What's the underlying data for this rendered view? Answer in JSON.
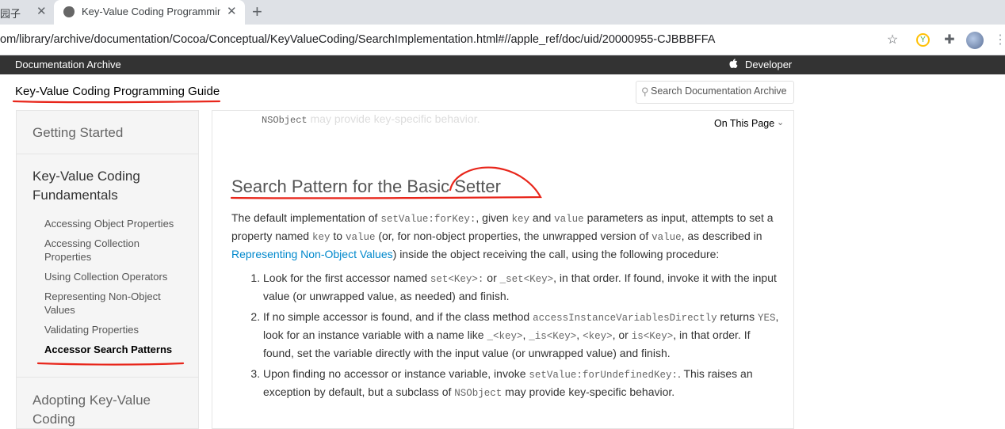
{
  "browser": {
    "prev_tab_title": "园子",
    "active_tab_title": "Key-Value Coding Programming Guide",
    "close_glyph": "✕",
    "new_tab_glyph": "+",
    "url": "om/library/archive/documentation/Cocoa/Conceptual/KeyValueCoding/SearchImplementation.html#//apple_ref/doc/uid/20000955-CJBBBFFA"
  },
  "site": {
    "archive_title": "Documentation Archive",
    "developer_label": "Developer",
    "guide_title": "Key-Value Coding Programming Guide",
    "search_placeholder": "Search Documentation Archive"
  },
  "sidebar": {
    "getting_started": "Getting Started",
    "section_title": "Key-Value Coding Fundamentals",
    "items": [
      "Accessing Object Properties",
      "Accessing Collection Properties",
      "Using Collection Operators",
      "Representing Non-Object Values",
      "Validating Properties",
      "Accessor Search Patterns"
    ],
    "next_section": "Adopting Key-Value Coding"
  },
  "content": {
    "ghost_code": "NSObject",
    "ghost_text": " may provide key-specific behavior.",
    "on_this_page": "On This Page",
    "heading": "Search Pattern for the Basic Setter",
    "intro": {
      "t1": "The default implementation of ",
      "c1": "setValue:forKey:",
      "t2": ", given ",
      "c2": "key",
      "t3": " and ",
      "c3": "value",
      "t4": " parameters as input, attempts to set a property named ",
      "c4": "key",
      "t5": " to ",
      "c5": "value",
      "t6": " (or, for non-object properties, the unwrapped version of ",
      "c6": "value",
      "t7": ", as described in ",
      "link": "Representing Non-Object Values",
      "t8": ") inside the object receiving the call, using the following procedure:"
    },
    "steps": [
      {
        "t1": "Look for the first accessor named ",
        "c1": "set<Key>:",
        "t2": " or ",
        "c2": "_set<Key>",
        "t3": ", in that order. If found, invoke it with the input value (or unwrapped value, as needed) and finish."
      },
      {
        "t1": "If no simple accessor is found, and if the class method ",
        "c1": "accessInstanceVariablesDirectly",
        "t2": " returns ",
        "c2": "YES",
        "t3": ", look for an instance variable with a name like ",
        "c3": "_<key>",
        "t4": ", ",
        "c4": "_is<Key>",
        "t5": ", ",
        "c5": "<key>",
        "t6": ", or ",
        "c6": "is<Key>",
        "t7": ", in that order. If found, set the variable directly with the input value (or unwrapped value) and finish."
      },
      {
        "t1": "Upon finding no accessor or instance variable, invoke ",
        "c1": "setValue:forUndefinedKey:",
        "t2": ". This raises an exception by default, but a subclass of ",
        "c2": "NSObject",
        "t3": " may provide key-specific behavior."
      }
    ]
  },
  "colors": {
    "annotation_red": "#e8261b",
    "link_blue": "#0088cc",
    "site_bar": "#333333"
  }
}
